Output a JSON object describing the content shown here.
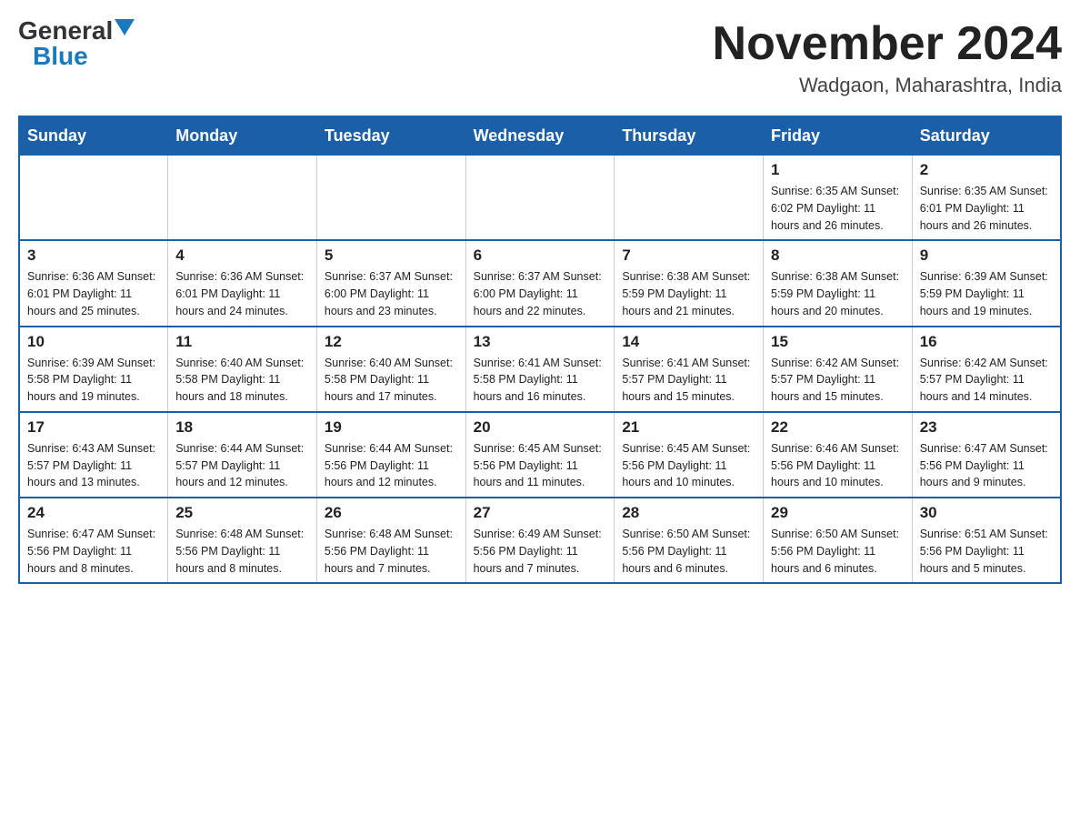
{
  "header": {
    "logo_general": "General",
    "logo_blue": "Blue",
    "month_title": "November 2024",
    "location": "Wadgaon, Maharashtra, India"
  },
  "days_of_week": [
    "Sunday",
    "Monday",
    "Tuesday",
    "Wednesday",
    "Thursday",
    "Friday",
    "Saturday"
  ],
  "weeks": [
    [
      {
        "day": "",
        "info": ""
      },
      {
        "day": "",
        "info": ""
      },
      {
        "day": "",
        "info": ""
      },
      {
        "day": "",
        "info": ""
      },
      {
        "day": "",
        "info": ""
      },
      {
        "day": "1",
        "info": "Sunrise: 6:35 AM\nSunset: 6:02 PM\nDaylight: 11 hours and 26 minutes."
      },
      {
        "day": "2",
        "info": "Sunrise: 6:35 AM\nSunset: 6:01 PM\nDaylight: 11 hours and 26 minutes."
      }
    ],
    [
      {
        "day": "3",
        "info": "Sunrise: 6:36 AM\nSunset: 6:01 PM\nDaylight: 11 hours and 25 minutes."
      },
      {
        "day": "4",
        "info": "Sunrise: 6:36 AM\nSunset: 6:01 PM\nDaylight: 11 hours and 24 minutes."
      },
      {
        "day": "5",
        "info": "Sunrise: 6:37 AM\nSunset: 6:00 PM\nDaylight: 11 hours and 23 minutes."
      },
      {
        "day": "6",
        "info": "Sunrise: 6:37 AM\nSunset: 6:00 PM\nDaylight: 11 hours and 22 minutes."
      },
      {
        "day": "7",
        "info": "Sunrise: 6:38 AM\nSunset: 5:59 PM\nDaylight: 11 hours and 21 minutes."
      },
      {
        "day": "8",
        "info": "Sunrise: 6:38 AM\nSunset: 5:59 PM\nDaylight: 11 hours and 20 minutes."
      },
      {
        "day": "9",
        "info": "Sunrise: 6:39 AM\nSunset: 5:59 PM\nDaylight: 11 hours and 19 minutes."
      }
    ],
    [
      {
        "day": "10",
        "info": "Sunrise: 6:39 AM\nSunset: 5:58 PM\nDaylight: 11 hours and 19 minutes."
      },
      {
        "day": "11",
        "info": "Sunrise: 6:40 AM\nSunset: 5:58 PM\nDaylight: 11 hours and 18 minutes."
      },
      {
        "day": "12",
        "info": "Sunrise: 6:40 AM\nSunset: 5:58 PM\nDaylight: 11 hours and 17 minutes."
      },
      {
        "day": "13",
        "info": "Sunrise: 6:41 AM\nSunset: 5:58 PM\nDaylight: 11 hours and 16 minutes."
      },
      {
        "day": "14",
        "info": "Sunrise: 6:41 AM\nSunset: 5:57 PM\nDaylight: 11 hours and 15 minutes."
      },
      {
        "day": "15",
        "info": "Sunrise: 6:42 AM\nSunset: 5:57 PM\nDaylight: 11 hours and 15 minutes."
      },
      {
        "day": "16",
        "info": "Sunrise: 6:42 AM\nSunset: 5:57 PM\nDaylight: 11 hours and 14 minutes."
      }
    ],
    [
      {
        "day": "17",
        "info": "Sunrise: 6:43 AM\nSunset: 5:57 PM\nDaylight: 11 hours and 13 minutes."
      },
      {
        "day": "18",
        "info": "Sunrise: 6:44 AM\nSunset: 5:57 PM\nDaylight: 11 hours and 12 minutes."
      },
      {
        "day": "19",
        "info": "Sunrise: 6:44 AM\nSunset: 5:56 PM\nDaylight: 11 hours and 12 minutes."
      },
      {
        "day": "20",
        "info": "Sunrise: 6:45 AM\nSunset: 5:56 PM\nDaylight: 11 hours and 11 minutes."
      },
      {
        "day": "21",
        "info": "Sunrise: 6:45 AM\nSunset: 5:56 PM\nDaylight: 11 hours and 10 minutes."
      },
      {
        "day": "22",
        "info": "Sunrise: 6:46 AM\nSunset: 5:56 PM\nDaylight: 11 hours and 10 minutes."
      },
      {
        "day": "23",
        "info": "Sunrise: 6:47 AM\nSunset: 5:56 PM\nDaylight: 11 hours and 9 minutes."
      }
    ],
    [
      {
        "day": "24",
        "info": "Sunrise: 6:47 AM\nSunset: 5:56 PM\nDaylight: 11 hours and 8 minutes."
      },
      {
        "day": "25",
        "info": "Sunrise: 6:48 AM\nSunset: 5:56 PM\nDaylight: 11 hours and 8 minutes."
      },
      {
        "day": "26",
        "info": "Sunrise: 6:48 AM\nSunset: 5:56 PM\nDaylight: 11 hours and 7 minutes."
      },
      {
        "day": "27",
        "info": "Sunrise: 6:49 AM\nSunset: 5:56 PM\nDaylight: 11 hours and 7 minutes."
      },
      {
        "day": "28",
        "info": "Sunrise: 6:50 AM\nSunset: 5:56 PM\nDaylight: 11 hours and 6 minutes."
      },
      {
        "day": "29",
        "info": "Sunrise: 6:50 AM\nSunset: 5:56 PM\nDaylight: 11 hours and 6 minutes."
      },
      {
        "day": "30",
        "info": "Sunrise: 6:51 AM\nSunset: 5:56 PM\nDaylight: 11 hours and 5 minutes."
      }
    ]
  ]
}
